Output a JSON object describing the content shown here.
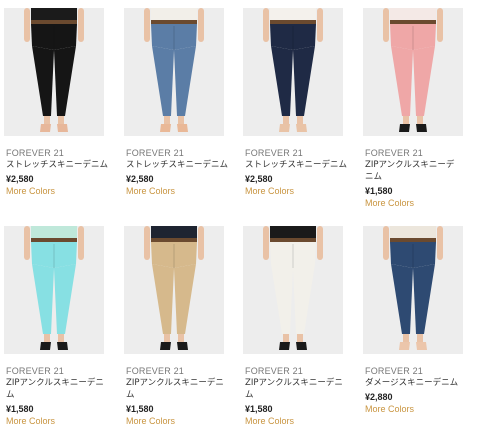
{
  "products": [
    {
      "brand": "FOREVER 21",
      "name": "ストレッチスキニーデニム",
      "price": "¥2,580",
      "more_colors": "More Colors",
      "jean_color": "#151515",
      "shoe_color": "#e7b79a",
      "top_color": "#1b1b1b"
    },
    {
      "brand": "FOREVER 21",
      "name": "ストレッチスキニーデニム",
      "price": "¥2,580",
      "more_colors": "More Colors",
      "jean_color": "#5b7da6",
      "shoe_color": "#e9b897",
      "top_color": "#f2efe9"
    },
    {
      "brand": "FOREVER 21",
      "name": "ストレッチスキニーデニム",
      "price": "¥2,580",
      "more_colors": "More Colors",
      "jean_color": "#1f2a45",
      "shoe_color": "#e9c3a6",
      "top_color": "#f4f1ec"
    },
    {
      "brand": "FOREVER 21",
      "name": "ZIPアンクルスキニーデニム",
      "price": "¥1,580",
      "more_colors": "More Colors",
      "jean_color": "#efa7a7",
      "shoe_color": "#1a1a1a",
      "top_color": "#f4e9e6"
    },
    {
      "brand": "FOREVER 21",
      "name": "ZIPアンクルスキニーデニム",
      "price": "¥1,580",
      "more_colors": "More Colors",
      "jean_color": "#87e0e3",
      "shoe_color": "#1a1a1a",
      "top_color": "#bfe8da"
    },
    {
      "brand": "FOREVER 21",
      "name": "ZIPアンクルスキニーデニム",
      "price": "¥1,580",
      "more_colors": "More Colors",
      "jean_color": "#d6b98c",
      "shoe_color": "#1a1a1a",
      "top_color": "#1e2431"
    },
    {
      "brand": "FOREVER 21",
      "name": "ZIPアンクルスキニーデニム",
      "price": "¥1,580",
      "more_colors": "More Colors",
      "jean_color": "#f2f0ea",
      "shoe_color": "#1a1a1a",
      "top_color": "#1a1a1a"
    },
    {
      "brand": "FOREVER 21",
      "name": "ダメージスキニーデニム",
      "price": "¥2,880",
      "more_colors": "More Colors",
      "jean_color": "#2e4a72",
      "shoe_color": "#ecc6ab",
      "top_color": "#ece6dc"
    }
  ]
}
